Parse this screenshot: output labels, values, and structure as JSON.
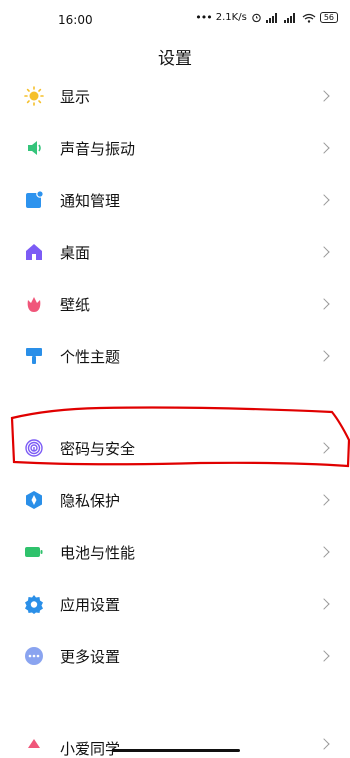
{
  "statusbar": {
    "time": "16:00",
    "network_speed": "2.1K/s",
    "battery": "56"
  },
  "header": {
    "title": "设置"
  },
  "menu": {
    "group1": [
      {
        "label": "显示",
        "icon": "sun-icon",
        "color": "#F5C02B"
      },
      {
        "label": "声音与振动",
        "icon": "speaker-icon",
        "color": "#35C47B"
      },
      {
        "label": "通知管理",
        "icon": "notification-icon",
        "color": "#2D93EE"
      },
      {
        "label": "桌面",
        "icon": "home-icon",
        "color": "#7C5CF5"
      },
      {
        "label": "壁纸",
        "icon": "flower-icon",
        "color": "#F0567A"
      },
      {
        "label": "个性主题",
        "icon": "brush-icon",
        "color": "#2A8FE8"
      }
    ],
    "group2": [
      {
        "label": "密码与安全",
        "icon": "fingerprint-icon",
        "color": "#7C5CF5"
      },
      {
        "label": "隐私保护",
        "icon": "privacy-icon",
        "color": "#2A8FE8"
      },
      {
        "label": "电池与性能",
        "icon": "battery-icon",
        "color": "#2FC26C"
      },
      {
        "label": "应用设置",
        "icon": "gear-icon",
        "color": "#2A8FE8"
      },
      {
        "label": "更多设置",
        "icon": "more-icon",
        "color": "#8AA4F0"
      }
    ],
    "partial": {
      "label": "小爱同学",
      "icon": "assistant-icon",
      "color": "#F0567A"
    }
  },
  "annotation_color": "#E00000"
}
